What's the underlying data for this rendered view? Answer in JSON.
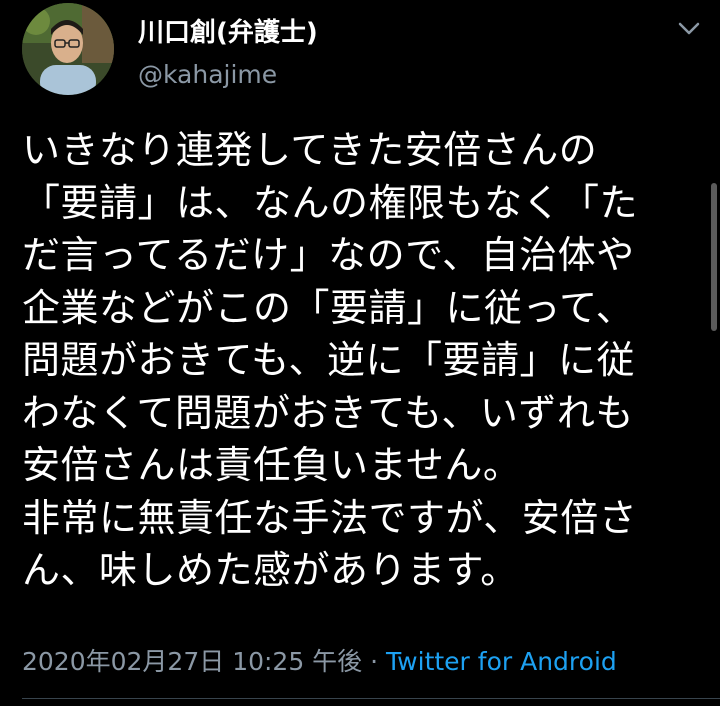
{
  "author": {
    "display_name": "川口創(弁護士)",
    "handle": "@kahajime",
    "avatar_icon": "profile-photo"
  },
  "tweet": {
    "text": "いきなり連発してきた安倍さんの\n「要請」は、なんの権限もなく「た\nだ言ってるだけ」なので、自治体や\n企業などがこの「要請」に従って、\n問題がおきても、逆に「要請」に従\nわなくて問題がおきても、いずれも\n安倍さんは責任負いません。\n非常に無責任な手法ですが、安倍さ\nん、味しめた感があります。",
    "timestamp": "2020年02月27日 10:25 午後",
    "separator": "·",
    "source": "Twitter for Android"
  },
  "icons": {
    "menu": "chevron-down-icon"
  },
  "colors": {
    "background": "#000000",
    "text": "#ffffff",
    "muted": "#8b98a5",
    "link": "#1da1f2"
  }
}
